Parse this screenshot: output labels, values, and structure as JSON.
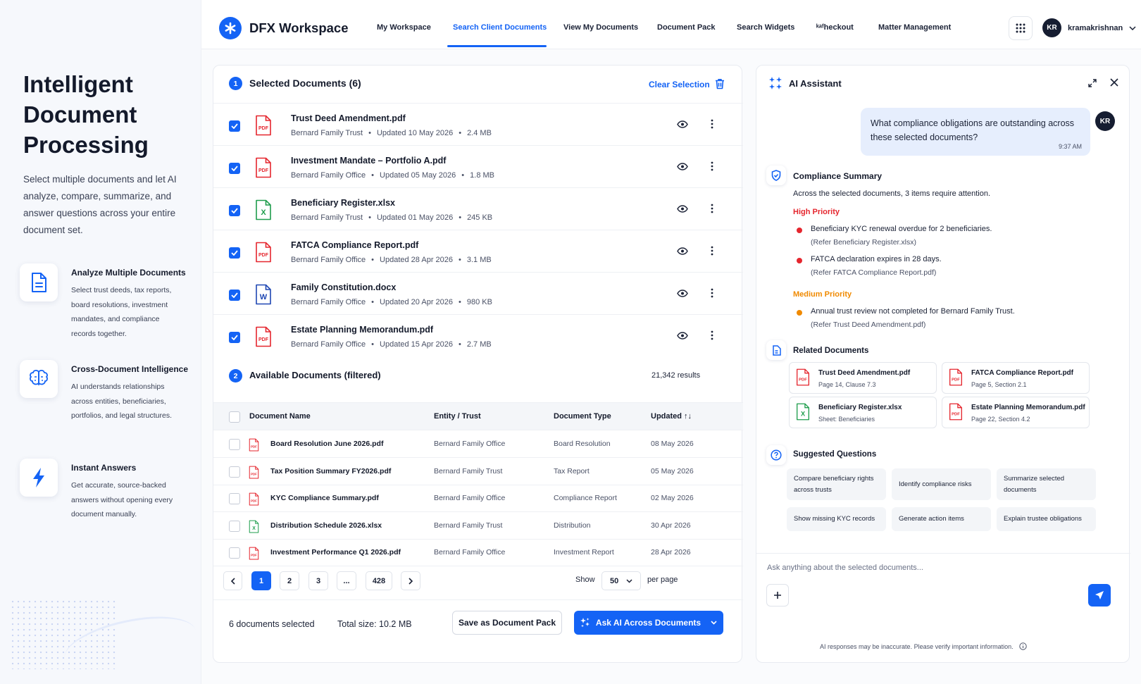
{
  "left": {
    "title": "Intelligent Document Processing",
    "intro": "Select multiple documents and let AI analyze, compare, summarize, and answer questions across your entire document set.",
    "features": [
      {
        "title": "Analyze Multiple Documents",
        "desc": "Select trust deeds, tax reports, board resolutions, investment mandates, and compliance records together.",
        "icon": "document-icon"
      },
      {
        "title": "Cross-Document Intelligence",
        "desc": "AI understands relationships across entities, beneficiaries, portfolios, and legal structures.",
        "icon": "brain-icon"
      },
      {
        "title": "Instant Answers",
        "desc": "Get accurate, source-backed answers without opening every document manually.",
        "icon": "lightning-icon"
      }
    ]
  },
  "header": {
    "brand": "DFX Workspace",
    "nav": [
      "My Workspace",
      "Search Client Documents",
      "View My Documents",
      "Document Pack",
      "Search Widgets",
      "ᵏᵃᶠheckout",
      "Matter Management"
    ],
    "active_nav": "Search Client Documents",
    "user_initials": "KR",
    "user_name": "kramakrishnan"
  },
  "selected": {
    "step": "1",
    "title": "Selected Documents (6)",
    "clear_label": "Clear Selection",
    "docs": [
      {
        "name": "Trust Deed Amendment.pdf",
        "entity": "Bernard Family Trust",
        "updated": "Updated 10 May 2026",
        "size": "2.4 MB",
        "type": "pdf"
      },
      {
        "name": "Investment Mandate – Portfolio A.pdf",
        "entity": "Bernard Family Office",
        "updated": "Updated 05 May 2026",
        "size": "1.8 MB",
        "type": "pdf"
      },
      {
        "name": "Beneficiary Register.xlsx",
        "entity": "Bernard Family Trust",
        "updated": "Updated 01 May 2026",
        "size": "245 KB",
        "type": "xlsx"
      },
      {
        "name": "FATCA Compliance Report.pdf",
        "entity": "Bernard Family Office",
        "updated": "Updated 28 Apr 2026",
        "size": "3.1 MB",
        "type": "pdf"
      },
      {
        "name": "Family Constitution.docx",
        "entity": "Bernard Family Office",
        "updated": "Updated 20 Apr 2026",
        "size": "980 KB",
        "type": "docx"
      },
      {
        "name": "Estate Planning Memorandum.pdf",
        "entity": "Bernard Family Office",
        "updated": "Updated 15 Apr 2026",
        "size": "2.7 MB",
        "type": "pdf"
      }
    ]
  },
  "available": {
    "step": "2",
    "title": "Available Documents (filtered)",
    "results": "21,342 results",
    "columns": [
      "Document Name",
      "Entity / Trust",
      "Document Type",
      "Updated ↑↓"
    ],
    "rows": [
      {
        "name": "Board Resolution June 2026.pdf",
        "entity": "Bernard Family Office",
        "type": "Board Resolution",
        "updated": "08 May 2026",
        "ft": "pdf"
      },
      {
        "name": "Tax Position Summary FY2026.pdf",
        "entity": "Bernard Family Trust",
        "type": "Tax Report",
        "updated": "05 May 2026",
        "ft": "pdf"
      },
      {
        "name": "KYC Compliance Summary.pdf",
        "entity": "Bernard Family Office",
        "type": "Compliance Report",
        "updated": "02 May 2026",
        "ft": "pdf"
      },
      {
        "name": "Distribution Schedule 2026.xlsx",
        "entity": "Bernard Family Trust",
        "type": "Distribution",
        "updated": "30 Apr 2026",
        "ft": "xlsx"
      },
      {
        "name": "Investment Performance Q1 2026.pdf",
        "entity": "Bernard Family Office",
        "type": "Investment Report",
        "updated": "28 Apr 2026",
        "ft": "pdf"
      }
    ],
    "pages": [
      "1",
      "2",
      "3",
      "...",
      "428"
    ],
    "current_page": "1",
    "show_label": "Show",
    "per_page_value": "50",
    "per_page_label": "per page"
  },
  "footer": {
    "selected_count": "6 documents selected",
    "total_size": "Total size: 10.2 MB",
    "save_pack": "Save as Document Pack",
    "ask_ai": "Ask AI Across Documents"
  },
  "ai": {
    "title": "AI Assistant",
    "question": "What compliance obligations are outstanding across these selected documents?",
    "question_time": "9:37 AM",
    "user_initials": "KR",
    "summary_title": "Compliance Summary",
    "summary_intro": "Across the selected documents, 3 items require attention.",
    "high_label": "High Priority",
    "high_items": [
      {
        "text": "Beneficiary KYC renewal overdue for 2 beneficiaries.",
        "ref": "(Refer Beneficiary Register.xlsx)"
      },
      {
        "text": "FATCA declaration expires in 28 days.",
        "ref": "(Refer FATCA Compliance Report.pdf)"
      }
    ],
    "medium_label": "Medium Priority",
    "medium_items": [
      {
        "text": "Annual trust review not completed for Bernard Family Trust.",
        "ref": "(Refer Trust Deed Amendment.pdf)"
      }
    ],
    "related_title": "Related Documents",
    "related": [
      {
        "name": "Trust Deed Amendment.pdf",
        "sub": "Page 14, Clause 7.3",
        "type": "pdf"
      },
      {
        "name": "FATCA Compliance Report.pdf",
        "sub": "Page 5, Section 2.1",
        "type": "pdf"
      },
      {
        "name": "Beneficiary Register.xlsx",
        "sub": "Sheet: Beneficiaries",
        "type": "xlsx"
      },
      {
        "name": "Estate Planning Memorandum.pdf",
        "sub": "Page 22, Section 4.2",
        "type": "pdf"
      }
    ],
    "suggested_title": "Suggested Questions",
    "suggested": [
      "Compare beneficiary rights across trusts",
      "Identify compliance risks",
      "Summarize selected documents",
      "Show missing KYC records",
      "Generate action items",
      "Explain trustee obligations"
    ],
    "input_placeholder": "Ask anything about the selected documents...",
    "disclaimer": "AI responses may be inaccurate. Please verify important information."
  },
  "colors": {
    "accent": "#1463f5",
    "high": "#e5262e",
    "medium": "#f08a00",
    "excel": "#1f9d4c"
  }
}
